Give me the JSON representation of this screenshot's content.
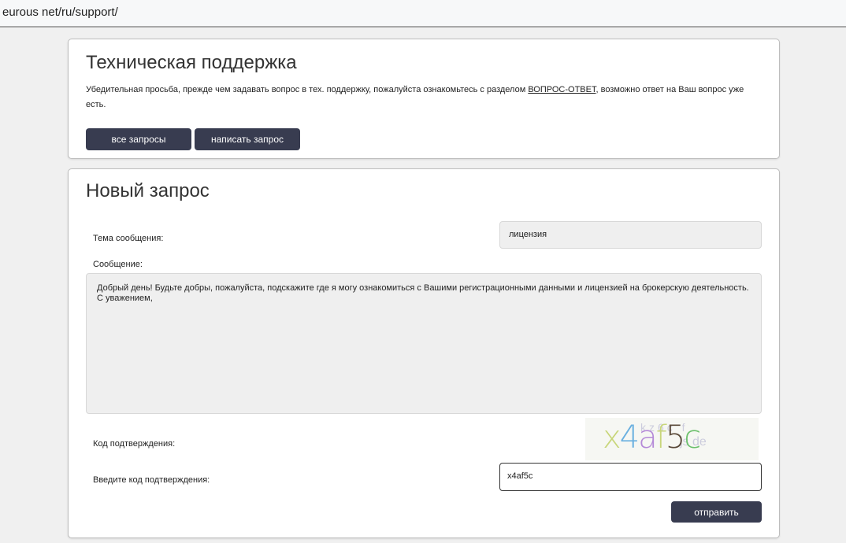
{
  "browser": {
    "url": "eurous net/ru/support/"
  },
  "support": {
    "title": "Техническая поддержка",
    "notice_before": "Убедительная просьба, прежде чем задавать вопрос в тех. поддержку, пожалуйста ознакомьтесь с разделом ",
    "notice_link": "ВОПРОС-ОТВЕТ",
    "notice_after": ", возможно ответ на Ваш вопрос уже есть.",
    "all_requests": "все запросы",
    "write_request": "написать запрос"
  },
  "form": {
    "title": "Новый запрос",
    "subject_label": "Тема сообщения:",
    "subject_value": "лицензия",
    "message_label": "Сообщение:",
    "message_value": "Добрый день! Будьте добры, пожалуйста, подскажите где я могу ознакомиться с Вашими регистрационными данными и лицензией на брокерскую деятельность.\nС уважением,",
    "captcha_label": "Код подтверждения:",
    "captcha_text": "x4af5c",
    "code_label": "Введите код подтверждения:",
    "code_value": "x4af5c",
    "submit": "отправить"
  }
}
